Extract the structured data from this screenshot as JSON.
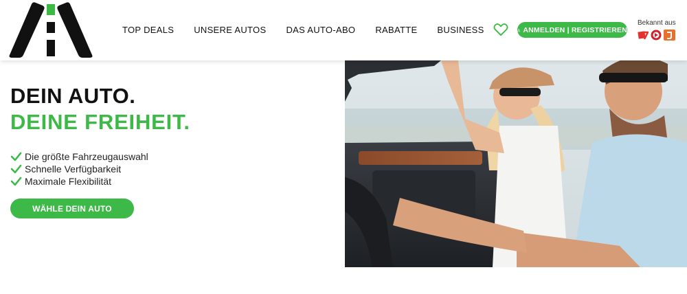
{
  "header": {
    "nav": [
      "TOP DEALS",
      "UNSERE AUTOS",
      "DAS AUTO-ABO",
      "RABATTE",
      "BUSINESS"
    ],
    "login_label": "ANMELDEN | REGISTRIEREN",
    "known_from_label": "Bekannt aus"
  },
  "hero": {
    "headline_line1": "DEIN AUTO.",
    "headline_line2": "DEINE FREIHEIT.",
    "features": [
      "Die größte Fahrzeugauswahl",
      "Schnelle Verfügbarkeit",
      "Maximale Flexibilität"
    ],
    "cta_label": "WÄHLE DEIN AUTO"
  },
  "colors": {
    "accent_green": "#3cb946",
    "logo_black": "#111111",
    "prosieben_red": "#e5312b",
    "rtl_orange": "#e8702a"
  },
  "icons": [
    "heart-icon",
    "user-icon",
    "check-icon"
  ]
}
